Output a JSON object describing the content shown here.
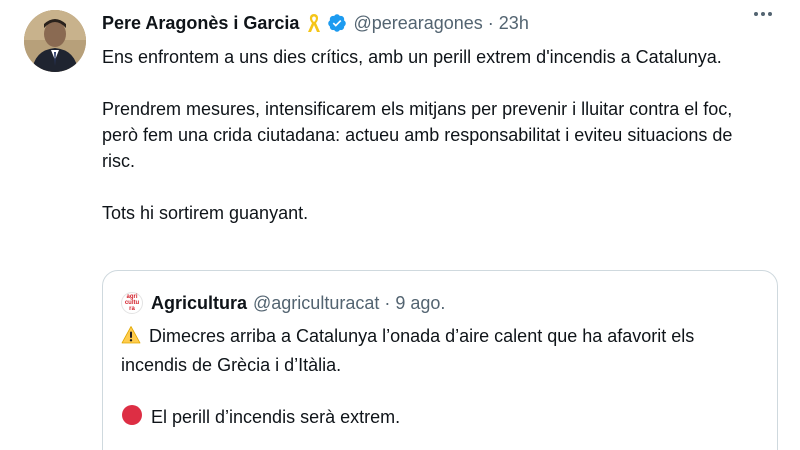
{
  "tweet": {
    "author_name": "Pere Aragonès i Garcia",
    "author_handle": "@perearagones",
    "separator": "·",
    "time": "23h",
    "paragraphs": [
      "Ens enfrontem a uns dies crítics, amb un perill extrem d'incendis a Catalunya.",
      "Prendrem mesures, intensificarem els mitjans per prevenir i lluitar contra el foc, però fem una crida ciutadana: actueu amb responsabilitat i eviteu situacions de risc.",
      "Tots hi sortirem guanyant."
    ],
    "icons": {
      "ribbon": "yellow-ribbon-icon",
      "verified": "verified-badge-icon",
      "more": "more-options-icon"
    },
    "colors": {
      "verified": "#1d9bf0",
      "ribbon": "#f5c518",
      "secondary_text": "#536471"
    }
  },
  "quoted_tweet": {
    "avatar_text": [
      "agri",
      "cultu",
      "ra"
    ],
    "author_name": "Agricultura",
    "author_handle": "@agriculturacat",
    "separator": "·",
    "time": "9 ago.",
    "paragraphs": [
      "Dimecres arriba a Catalunya l’onada d’aire calent que ha afavorit els incendis de Grècia i d’Itàlia.",
      "El perill d’incendis serà extrem."
    ],
    "icons": {
      "warning": "warning-icon",
      "red_circle": "red-circle-icon"
    }
  }
}
